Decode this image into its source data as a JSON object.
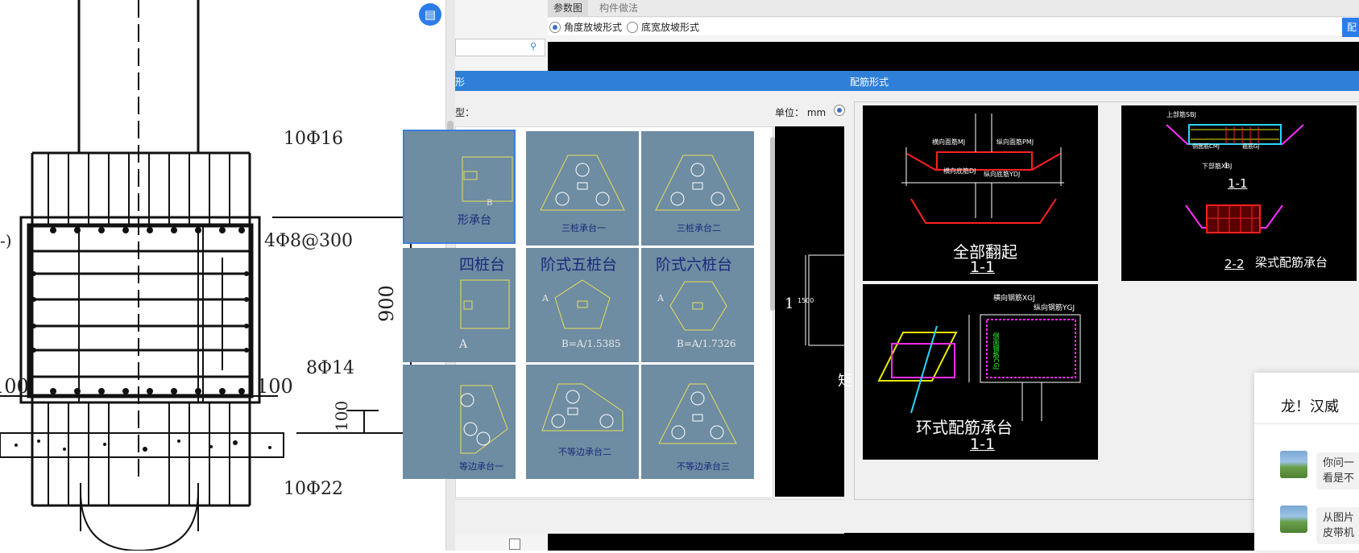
{
  "drawing": {
    "label_top": "10Φ16",
    "label_stirrup": "4Φ8@300",
    "label_mid": "8Φ14",
    "label_dim_900": "900",
    "label_dim_100_left": "100",
    "label_dim_100_right": "100",
    "label_dim_100_vert": "100",
    "label_bottom": "10Φ22",
    "label_paren": "-)"
  },
  "parent": {
    "tab_params": "参数图",
    "tab_method": "构件做法",
    "radio_angle": "角度放坡形式",
    "radio_width": "底宽放坡形式",
    "blue_btn": "配"
  },
  "dialog": {
    "title": "配筋形式",
    "title_left_fragment": "形",
    "type_label": "型：",
    "unit_label": "单位： mm",
    "thumbs": [
      {
        "name": "矩形承台",
        "caption": "形承台",
        "cell_label": "B"
      },
      {
        "name": "三桩承台一",
        "caption": "三桩承台一"
      },
      {
        "name": "三桩承台二",
        "caption": "三桩承台二"
      },
      {
        "name": "四桩台",
        "big": "四桩台",
        "cell_label": "A"
      },
      {
        "name": "阶式五桩台",
        "big": "阶式五桩台",
        "formula": "B=A/1.5385",
        "side": "A"
      },
      {
        "name": "阶式六桩台",
        "big": "阶式六桩台",
        "formula": "B=A/1.7326",
        "side": "A"
      },
      {
        "name": "不等边承台一",
        "caption": "等边承台一"
      },
      {
        "name": "不等边承台二",
        "caption": "不等边承台二"
      },
      {
        "name": "不等边承台三",
        "caption": "不等边承台三"
      }
    ],
    "preview_num": "1",
    "preview_dim": "1500",
    "preview_char": "矩"
  },
  "rebar": {
    "cell1": {
      "caption": "全部翻起",
      "section": "1-1",
      "labels": [
        "横向面筋MJ",
        "纵向面筋PMJ",
        "横向底筋DJ",
        "纵向底筋YDJ"
      ]
    },
    "cell2": {
      "caption": "梁式配筋承台",
      "section_a": "1-1",
      "section_b": "2-2",
      "labels": [
        "上部筋SBJ",
        "下部筋XBJ",
        "侧面筋CMJ",
        "箍筋GJ"
      ]
    },
    "cell3": {
      "caption": "环式配筋承台",
      "section": "1-1",
      "labels": [
        "横向钢筋XGJ",
        "纵向钢筋YGJ",
        "侧面钢筋CGJ"
      ]
    }
  },
  "chat": {
    "title": "龙！汉威",
    "messages": [
      {
        "text": "你问一\n看是不"
      },
      {
        "text": "从图片\n皮带机"
      }
    ]
  }
}
